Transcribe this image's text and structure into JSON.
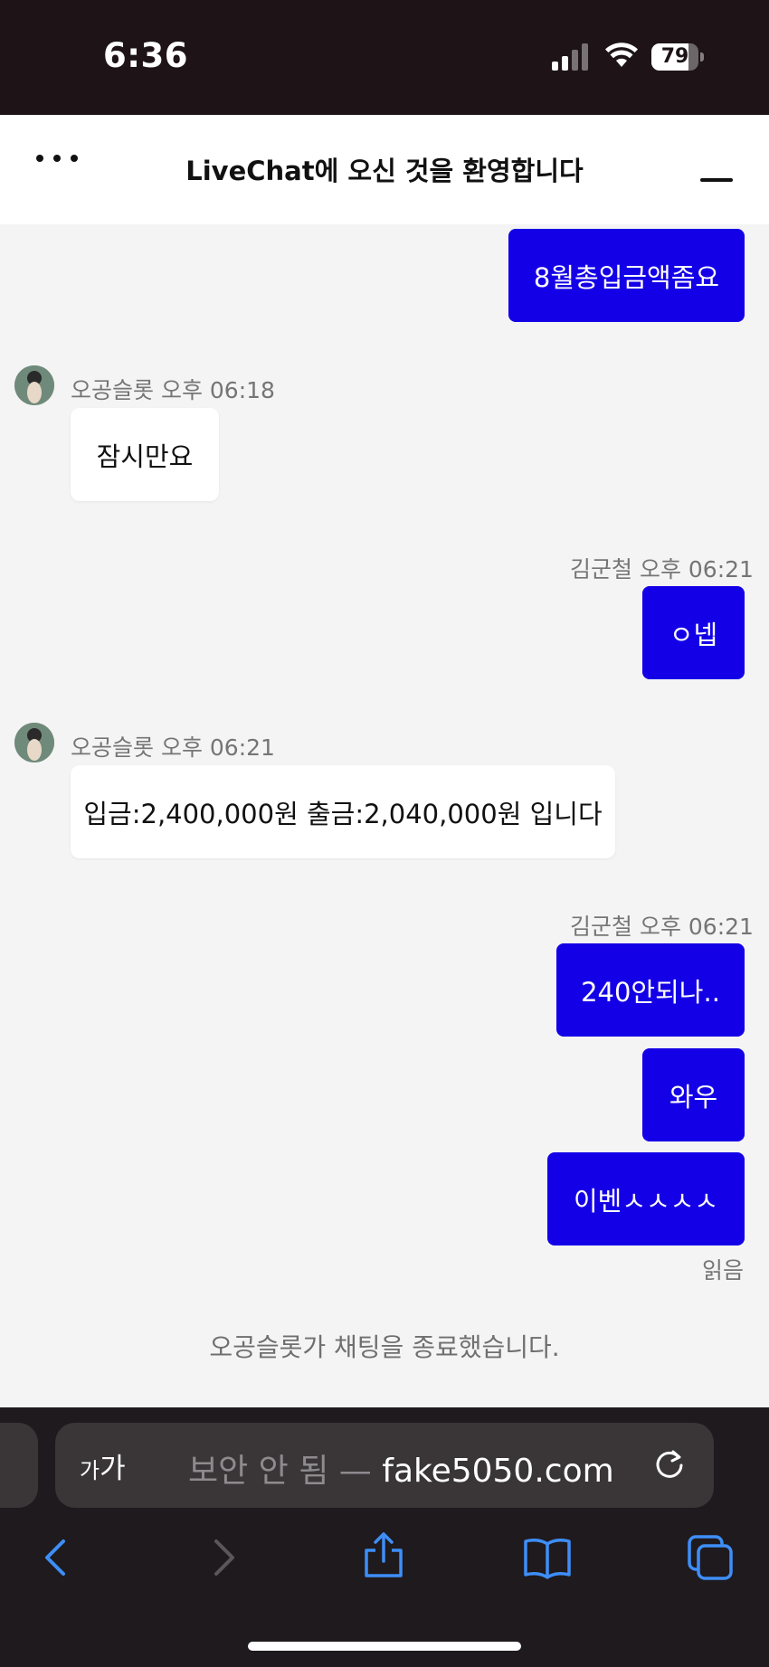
{
  "status_bar": {
    "time": "6:36",
    "battery": "79",
    "battery_level": 0.79
  },
  "header": {
    "title": "LiveChat에 오신 것을 환영합니다"
  },
  "messages": [
    {
      "text": "8월총입금액좀요"
    },
    {
      "meta": "오공슬롯 오후 06:18",
      "text": "잠시만요"
    },
    {
      "meta": "김군철 오후 06:21",
      "text": "ㅇ넵"
    },
    {
      "meta": "오공슬롯 오후 06:21",
      "text": "입금:2,400,000원 출금:2,040,000원 입니다"
    },
    {
      "meta": "김군철 오후 06:21",
      "text": "240안되나.."
    },
    {
      "text": "와우"
    },
    {
      "text": "이벤ㅅㅅㅅㅅ",
      "status": "읽음"
    }
  ],
  "system_message": "오공슬롯가 채팅을 종료했습니다.",
  "browser": {
    "aa_small": "가",
    "aa_large": "가",
    "url_prefix": "보안 안 됨 — ",
    "url_domain": "fake5050.com"
  },
  "colors": {
    "outgoing_bubble": "#1400e6",
    "toolbar_accent": "#3e8ef7",
    "status_bar_bg": "#1e1418"
  },
  "icons": [
    "signal-icon",
    "wifi-icon",
    "battery-icon",
    "menu-dots-icon",
    "minimize-icon",
    "avatar",
    "reload-icon",
    "back-icon",
    "forward-icon",
    "share-icon",
    "bookmarks-icon",
    "tabs-icon"
  ]
}
